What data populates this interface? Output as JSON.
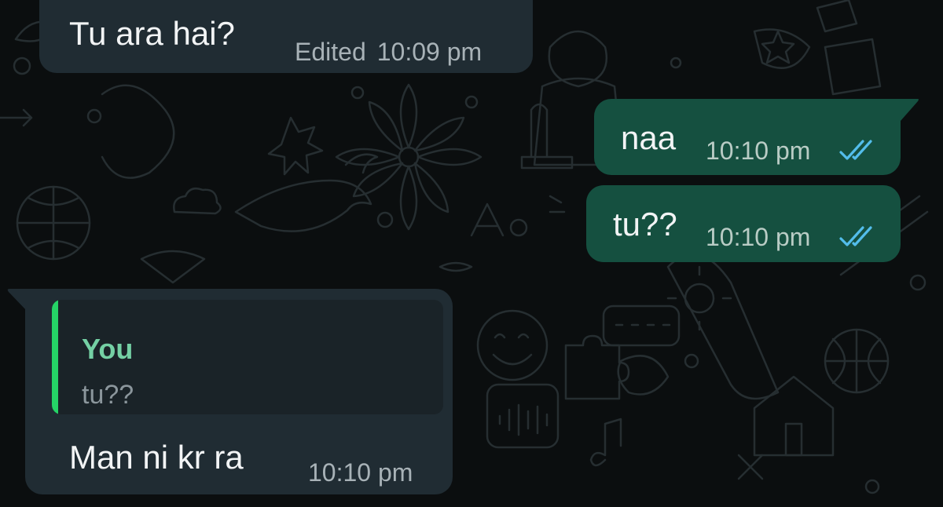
{
  "colors": {
    "background": "#0b0e0f",
    "incoming_bubble": "#202c33",
    "outgoing_bubble": "#155040",
    "read_ticks": "#53bdeb",
    "quote_accent": "#25d366",
    "quote_author": "#74d0a4"
  },
  "messages": [
    {
      "direction": "incoming",
      "text": "Tu ara hai?",
      "edited_label": "Edited",
      "time": "10:09 pm"
    },
    {
      "direction": "outgoing",
      "text": "naa",
      "time": "10:10 pm",
      "status_icon": "double-check-read-icon"
    },
    {
      "direction": "outgoing",
      "text": "tu??",
      "time": "10:10 pm",
      "status_icon": "double-check-read-icon"
    },
    {
      "direction": "incoming",
      "quoted": {
        "author": "You",
        "text": "tu??"
      },
      "text": "Man ni kr ra",
      "time": "10:10 pm"
    }
  ]
}
